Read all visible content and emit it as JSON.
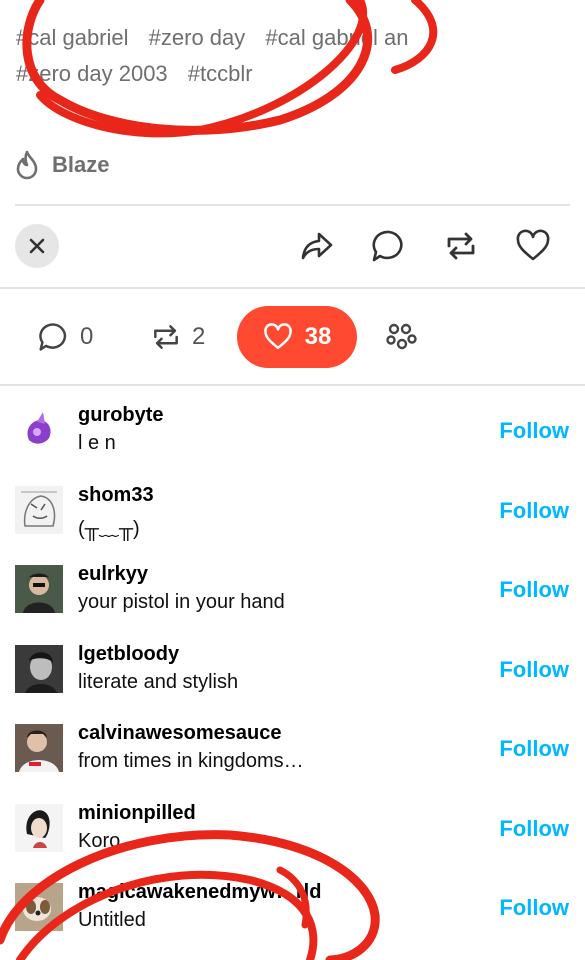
{
  "tags": [
    "#cal gabriel",
    "#zero day",
    "#cal gabriel an",
    "#zero day 2003",
    "#tccblr"
  ],
  "blaze_label": "Blaze",
  "actions": {
    "close_icon": "close-icon",
    "share_icon": "share-icon",
    "reply_icon": "comment-icon",
    "reblog_icon": "reblog-icon",
    "like_icon": "heart-icon"
  },
  "counts": {
    "replies": "0",
    "reblogs": "2",
    "likes": "38",
    "community_icon": "community-icon"
  },
  "notes": [
    {
      "username": "gurobyte",
      "title": "l e n",
      "follow": "Follow"
    },
    {
      "username": "shom33",
      "title": "(╥﹏╥)",
      "follow": "Follow"
    },
    {
      "username": "eulrkyy",
      "title": "your pistol in your hand",
      "follow": "Follow"
    },
    {
      "username": "lgetbloody",
      "title": "literate and stylish",
      "follow": "Follow"
    },
    {
      "username": "calvinawesomesauce",
      "title": "from times in kingdoms…",
      "follow": "Follow"
    },
    {
      "username": "minionpilled",
      "title": "Koro…",
      "follow": "Follow"
    },
    {
      "username": "magicawakenedmyw…rld",
      "title": "Untitled",
      "follow": "Follow"
    }
  ],
  "colors": {
    "accent_red": "#ff4930",
    "follow_blue": "#00b8ff",
    "scribble_red": "#e8271a"
  }
}
